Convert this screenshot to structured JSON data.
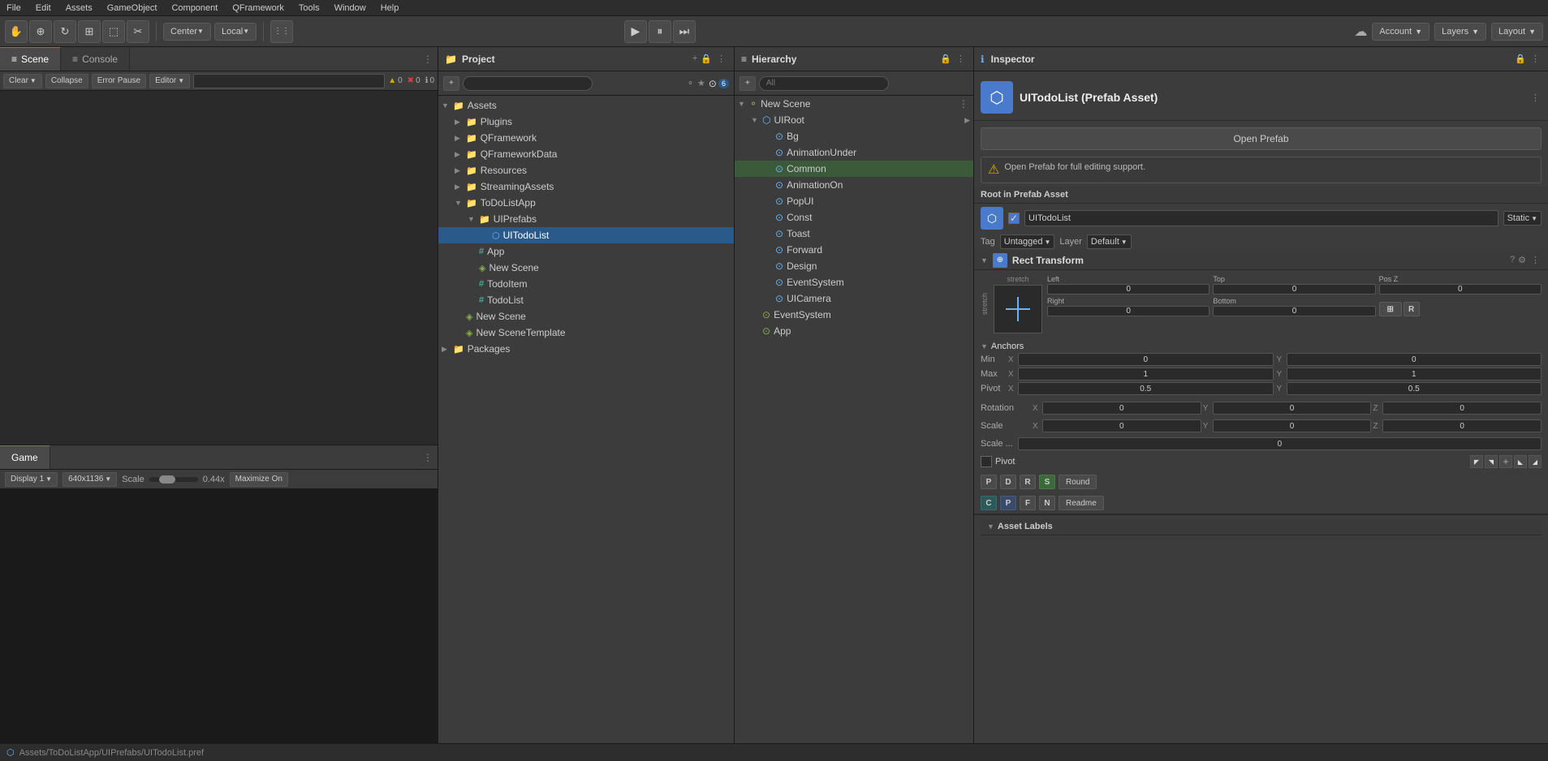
{
  "menubar": {
    "items": [
      "File",
      "Edit",
      "Assets",
      "GameObject",
      "Component",
      "QFramework",
      "Tools",
      "Window",
      "Help"
    ]
  },
  "toolbar": {
    "pivot_label": "Center",
    "local_label": "Local",
    "play_tip": "Play",
    "pause_tip": "Pause",
    "step_tip": "Step",
    "account_label": "Account",
    "layers_label": "Layers",
    "layout_label": "Layout"
  },
  "scene_tab": {
    "label": "Scene",
    "icon": "≡"
  },
  "console_tab": {
    "label": "Console",
    "icon": "≡"
  },
  "console_toolbar": {
    "clear_label": "Clear",
    "collapse_label": "Collapse",
    "error_pause_label": "Error Pause",
    "editor_label": "Editor",
    "search_placeholder": "",
    "warn_count": "0",
    "error_count": "0",
    "info_count": "0"
  },
  "game_tab": {
    "label": "Game"
  },
  "game_toolbar": {
    "display_label": "Display 1",
    "resolution_label": "640x1136",
    "scale_label": "Scale",
    "scale_value": "0.44x",
    "maximize_label": "Maximize On"
  },
  "project_panel": {
    "title": "Project",
    "add_label": "+",
    "search_placeholder": "",
    "badge": "6"
  },
  "project_tree": {
    "items": [
      {
        "label": "Assets",
        "type": "folder",
        "level": 0,
        "expanded": true
      },
      {
        "label": "Plugins",
        "type": "folder",
        "level": 1,
        "expanded": false
      },
      {
        "label": "QFramework",
        "type": "folder",
        "level": 1,
        "expanded": false
      },
      {
        "label": "QFrameworkData",
        "type": "folder",
        "level": 1,
        "expanded": false
      },
      {
        "label": "Resources",
        "type": "folder",
        "level": 1,
        "expanded": false
      },
      {
        "label": "StreamingAssets",
        "type": "folder",
        "level": 1,
        "expanded": false
      },
      {
        "label": "ToDoListApp",
        "type": "folder",
        "level": 1,
        "expanded": true
      },
      {
        "label": "UIPrefabs",
        "type": "folder",
        "level": 2,
        "expanded": true
      },
      {
        "label": "UITodoList",
        "type": "prefab",
        "level": 3,
        "expanded": false,
        "selected": true
      },
      {
        "label": "App",
        "type": "cs",
        "level": 2,
        "expanded": false
      },
      {
        "label": "New Scene",
        "type": "scene",
        "level": 2,
        "expanded": false
      },
      {
        "label": "TodoItem",
        "type": "cs",
        "level": 2,
        "expanded": false
      },
      {
        "label": "TodoList",
        "type": "cs",
        "level": 2,
        "expanded": false
      },
      {
        "label": "New Scene",
        "type": "scene",
        "level": 1,
        "expanded": false
      },
      {
        "label": "New SceneTemplate",
        "type": "scene",
        "level": 1,
        "expanded": false
      },
      {
        "label": "Packages",
        "type": "folder",
        "level": 0,
        "expanded": false
      }
    ]
  },
  "hierarchy_panel": {
    "title": "Hierarchy",
    "search_placeholder": "All"
  },
  "hierarchy_tree": {
    "items": [
      {
        "label": "New Scene",
        "type": "scene",
        "level": 0,
        "expanded": true
      },
      {
        "label": "UIRoot",
        "type": "ui",
        "level": 1,
        "expanded": true
      },
      {
        "label": "Bg",
        "type": "go",
        "level": 2,
        "expanded": false
      },
      {
        "label": "AnimationUnder",
        "type": "ui",
        "level": 2,
        "expanded": false
      },
      {
        "label": "Common",
        "type": "ui",
        "level": 2,
        "expanded": false
      },
      {
        "label": "AnimationOn",
        "type": "ui",
        "level": 2,
        "expanded": false
      },
      {
        "label": "PopUI",
        "type": "ui",
        "level": 2,
        "expanded": false
      },
      {
        "label": "Const",
        "type": "ui",
        "level": 2,
        "expanded": false
      },
      {
        "label": "Toast",
        "type": "ui",
        "level": 2,
        "expanded": false
      },
      {
        "label": "Forward",
        "type": "ui",
        "level": 2,
        "expanded": false
      },
      {
        "label": "Design",
        "type": "ui",
        "level": 2,
        "expanded": false
      },
      {
        "label": "EventSystem",
        "type": "ui",
        "level": 2,
        "expanded": false
      },
      {
        "label": "UICamera",
        "type": "ui",
        "level": 2,
        "expanded": false
      },
      {
        "label": "EventSystem",
        "type": "go",
        "level": 1,
        "expanded": false
      },
      {
        "label": "App",
        "type": "go",
        "level": 1,
        "expanded": false
      }
    ]
  },
  "inspector_panel": {
    "title": "Inspector",
    "asset_title": "UITodoList (Prefab Asset)",
    "open_prefab_label": "Open Prefab",
    "warning_text": "Open Prefab for full editing support.",
    "root_label": "Root in Prefab Asset",
    "prefab_name": "UITodoList",
    "static_label": "Static",
    "tag_label": "Tag",
    "tag_value": "Untagged",
    "layer_label": "Layer",
    "layer_value": "Default",
    "rect_transform_title": "Rect Transform",
    "stretch_label": "stretch",
    "left_label": "Left",
    "left_value": "0",
    "top_label": "Top",
    "top_value": "0",
    "pos_z_label": "Pos Z",
    "pos_z_value": "0",
    "right_label": "Right",
    "right_value": "0",
    "bottom_label": "Bottom",
    "bottom_value": "0",
    "anchors_label": "Anchors",
    "min_label": "Min",
    "min_x": "0",
    "min_y": "0",
    "max_label": "Max",
    "max_x": "1",
    "max_y": "1",
    "pivot_label": "Pivot",
    "pivot_x": "0.5",
    "pivot_y": "0.5",
    "rotation_label": "Rotation",
    "rot_x": "0",
    "rot_y": "0",
    "rot_z": "0",
    "scale_label": "Scale",
    "scale_x": "0",
    "scale_y": "0",
    "scale_z": "0",
    "scale_extra_label": "Scale ...",
    "scale_extra_value": "0",
    "pivot_checkbox_label": "Pivot",
    "round_label": "Round",
    "readme_label": "Readme",
    "asset_labels_label": "Asset Labels",
    "p_btn": "P",
    "d_btn": "D",
    "r_btn": "R",
    "s_btn": "S",
    "n_btn": "N",
    "c_btn": "C",
    "f_btn": "F"
  },
  "status_bar": {
    "path": "Assets/ToDoListApp/UIPrefabs/UITodoList.pref"
  }
}
